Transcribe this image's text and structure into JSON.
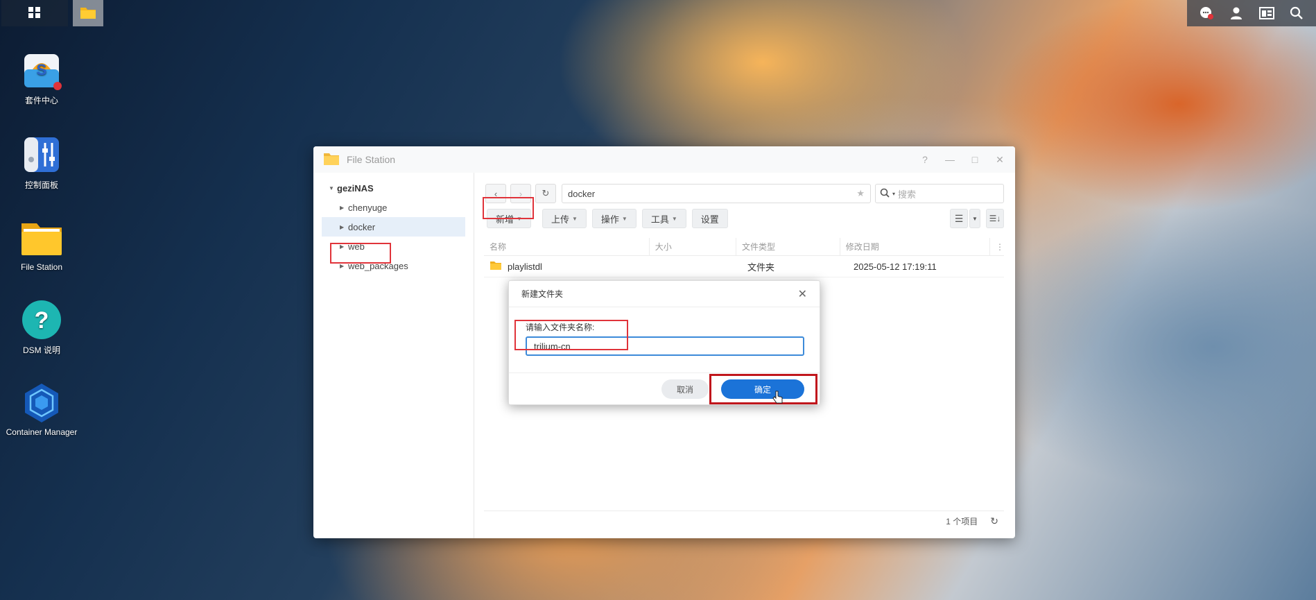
{
  "taskbar": {
    "main_menu_icon": "grid-icon",
    "filestation_icon": "folder-icon",
    "tray": [
      "chat-notification-icon",
      "user-icon",
      "widget-icon",
      "search-icon"
    ]
  },
  "desktop_icons": [
    {
      "label": "套件中心",
      "icon": "package-center-icon"
    },
    {
      "label": "控制面板",
      "icon": "control-panel-icon"
    },
    {
      "label": "File Station",
      "icon": "folder-icon"
    },
    {
      "label": "DSM 说明",
      "icon": "help-icon"
    },
    {
      "label": "Container Manager",
      "icon": "container-icon"
    }
  ],
  "window": {
    "title": "File Station",
    "controls": [
      "?",
      "—",
      "□",
      "✕"
    ],
    "tree": {
      "root": "geziNAS",
      "items": [
        "chenyuge",
        "docker",
        "web",
        "web_packages"
      ],
      "selected": "docker"
    },
    "path": "docker",
    "search_placeholder": "搜索",
    "toolbar": {
      "create": "新增",
      "upload": "上传",
      "action": "操作",
      "tools": "工具",
      "settings": "设置"
    },
    "columns": {
      "name": "名称",
      "size": "大小",
      "type": "文件类型",
      "modified": "修改日期"
    },
    "rows": [
      {
        "name": "playlistdl",
        "size": "",
        "type": "文件夹",
        "modified": "2025-05-12 17:19:11"
      }
    ],
    "status": "1 个项目"
  },
  "dialog": {
    "title": "新建文件夹",
    "label": "请输入文件夹名称:",
    "input_value": "trilium-cn",
    "cancel": "取消",
    "ok": "确定"
  },
  "colors": {
    "accent": "#1b73d8",
    "highlight_box": "#e0333a"
  }
}
